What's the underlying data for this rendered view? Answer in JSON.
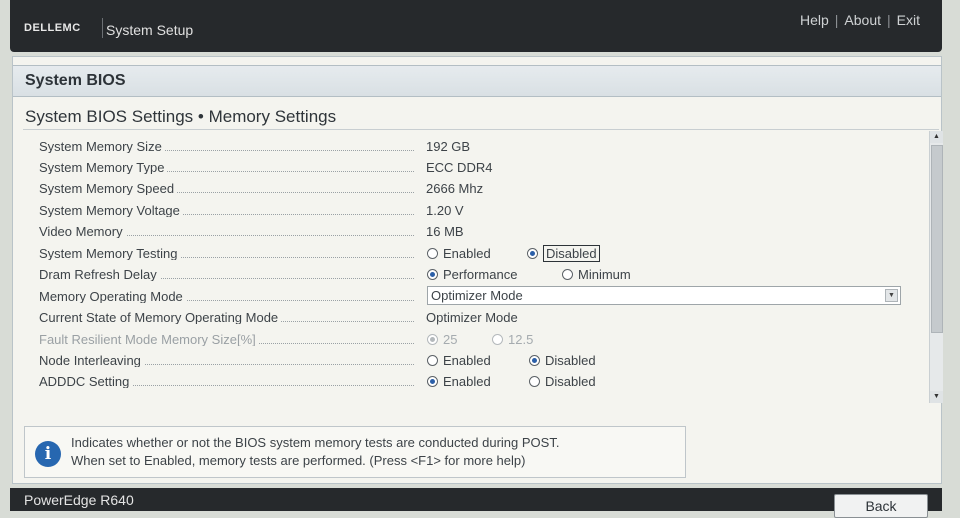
{
  "header": {
    "brand": "DELLEMC",
    "app_title": "System Setup",
    "links": {
      "help": "Help",
      "about": "About",
      "exit": "Exit"
    }
  },
  "panel": {
    "header_title": "System BIOS",
    "page_title": "System BIOS Settings • Memory Settings"
  },
  "settings": {
    "memory_size": {
      "label": "System Memory Size",
      "value": "192 GB"
    },
    "memory_type": {
      "label": "System Memory Type",
      "value": "ECC DDR4"
    },
    "memory_speed": {
      "label": "System Memory Speed",
      "value": "2666 Mhz"
    },
    "memory_voltage": {
      "label": "System Memory Voltage",
      "value": "1.20 V"
    },
    "video_memory": {
      "label": "Video Memory",
      "value": "16 MB"
    },
    "memory_testing": {
      "label": "System Memory Testing",
      "options": [
        "Enabled",
        "Disabled"
      ],
      "selected": "Disabled"
    },
    "dram_refresh": {
      "label": "Dram Refresh Delay",
      "options": [
        "Performance",
        "Minimum"
      ],
      "selected": "Performance"
    },
    "operating_mode": {
      "label": "Memory Operating Mode",
      "value": "Optimizer Mode"
    },
    "current_mode": {
      "label": "Current State of Memory Operating Mode",
      "value": "Optimizer Mode"
    },
    "fault_resilient": {
      "label": "Fault Resilient Mode Memory Size[%]",
      "options": [
        "25",
        "12.5"
      ],
      "selected": "25"
    },
    "node_interleaving": {
      "label": "Node Interleaving",
      "options": [
        "Enabled",
        "Disabled"
      ],
      "selected": "Disabled"
    },
    "adddc": {
      "label": "ADDDC Setting",
      "options": [
        "Enabled",
        "Disabled"
      ],
      "selected": "Enabled"
    }
  },
  "help": {
    "line1": "Indicates whether or not the BIOS system memory tests are conducted during POST.",
    "line2": "When set to Enabled, memory tests are performed. (Press <F1> for more help)"
  },
  "footer": {
    "model": "PowerEdge R640",
    "back_label": "Back"
  },
  "colors": {
    "header_bg": "#26292c",
    "panel_bg": "#f4f4ef",
    "radio_selected": "#2b5fa8",
    "info_icon": "#2767b0"
  }
}
